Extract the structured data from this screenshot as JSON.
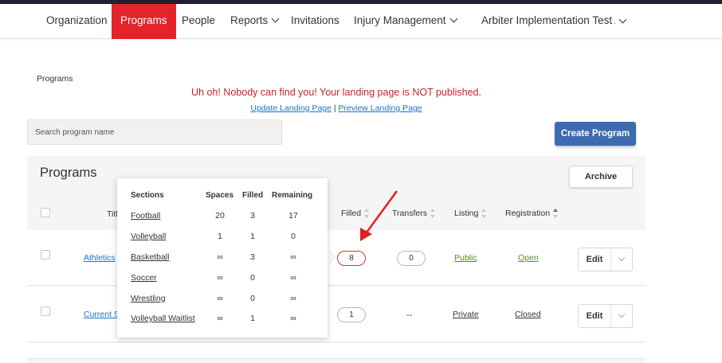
{
  "nav": {
    "items": [
      {
        "label": "Organization",
        "active": false,
        "dropdown": false
      },
      {
        "label": "Programs",
        "active": true,
        "dropdown": false
      },
      {
        "label": "People",
        "active": false,
        "dropdown": false
      },
      {
        "label": "Reports",
        "active": false,
        "dropdown": true
      },
      {
        "label": "Invitations",
        "active": false,
        "dropdown": false
      },
      {
        "label": "Injury Management",
        "active": false,
        "dropdown": true
      },
      {
        "label": "Arbiter Implementation Test Ac",
        "active": false,
        "dropdown": true
      }
    ]
  },
  "page": {
    "breadcrumb": "Programs",
    "warning": "Uh oh! Nobody can find you! Your landing page is NOT published.",
    "update_link": "Update Landing Page",
    "separator": "|",
    "preview_link": "Preview Landing Page"
  },
  "search": {
    "placeholder": "Search program name",
    "value": ""
  },
  "create_button": "Create Program",
  "programs": {
    "title": "Programs",
    "archive_button": "Archive",
    "columns": {
      "title": "Title",
      "filled": "Filled",
      "transfers": "Transfers",
      "listing": "Listing",
      "registration": "Registration"
    },
    "rows": [
      {
        "title": "Athletics",
        "filled": "8",
        "transfers": "0",
        "listing": "Public",
        "registration": "Open",
        "edit": "Edit"
      },
      {
        "title": "Current S",
        "filled": "1",
        "transfers": "--",
        "listing": "Private",
        "registration": "Closed",
        "edit": "Edit"
      }
    ]
  },
  "sections_popup": {
    "headers": {
      "sections": "Sections",
      "spaces": "Spaces",
      "filled": "Filled",
      "remaining": "Remaining"
    },
    "rows": [
      {
        "name": "Football",
        "spaces": "20",
        "filled": "3",
        "remaining": "17"
      },
      {
        "name": "Volleyball",
        "spaces": "1",
        "filled": "1",
        "remaining": "0"
      },
      {
        "name": "Basketball",
        "spaces": "∞",
        "filled": "3",
        "remaining": "∞"
      },
      {
        "name": "Soccer",
        "spaces": "∞",
        "filled": "0",
        "remaining": "∞"
      },
      {
        "name": "Wrestling",
        "spaces": "∞",
        "filled": "0",
        "remaining": "∞"
      },
      {
        "name": "Volleyball Waitlist",
        "spaces": "∞",
        "filled": "1",
        "remaining": "∞"
      }
    ]
  },
  "colors": {
    "nav_active": "#e3242b",
    "primary_button": "#3d6bb0",
    "warning_text": "#c0262d",
    "link": "#1a73c9",
    "status_green": "#5b8a1f",
    "annotation_arrow": "#e02020"
  }
}
